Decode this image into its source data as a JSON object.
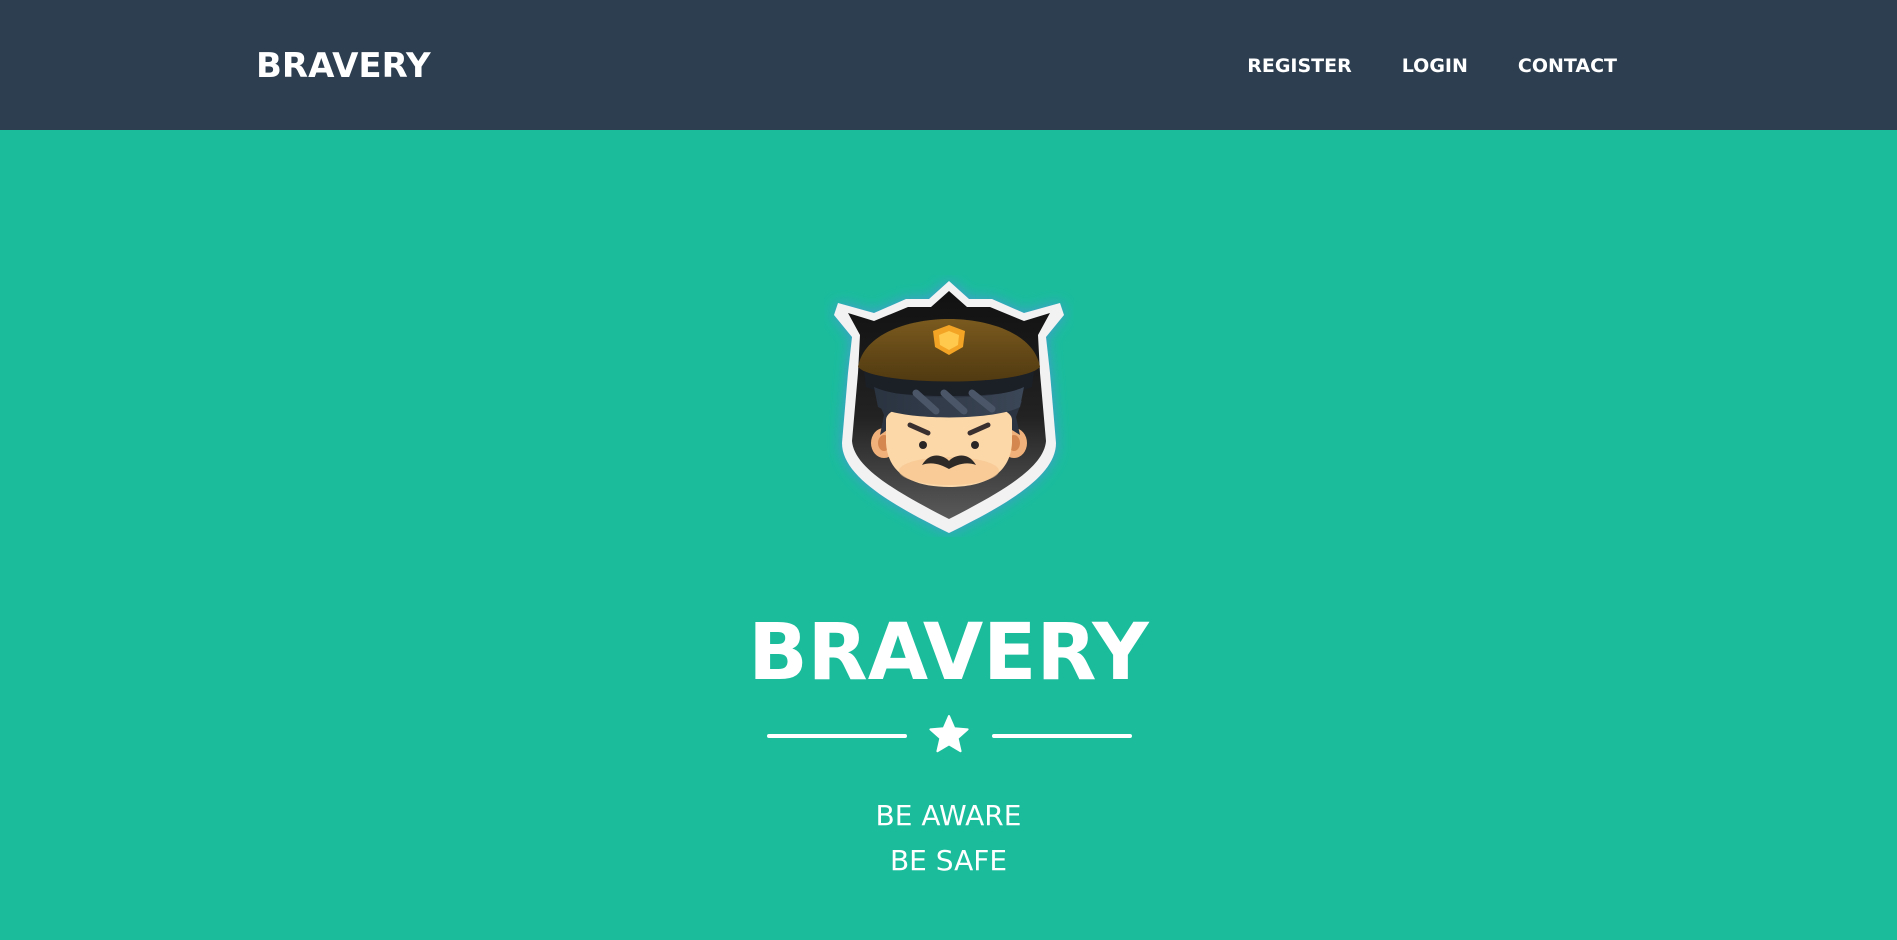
{
  "navbar": {
    "brand": "BRAVERY",
    "links": [
      "REGISTER",
      "LOGIN",
      "CONTACT"
    ]
  },
  "hero": {
    "avatar_icon": "police-officer-badge-icon",
    "title": "BRAVERY",
    "divider_icon": "star-icon",
    "tagline": [
      "BE AWARE",
      "BE SAFE"
    ]
  },
  "colors": {
    "navbar_bg": "#2c3e50",
    "hero_bg": "#1abc9c",
    "text": "#ffffff"
  }
}
